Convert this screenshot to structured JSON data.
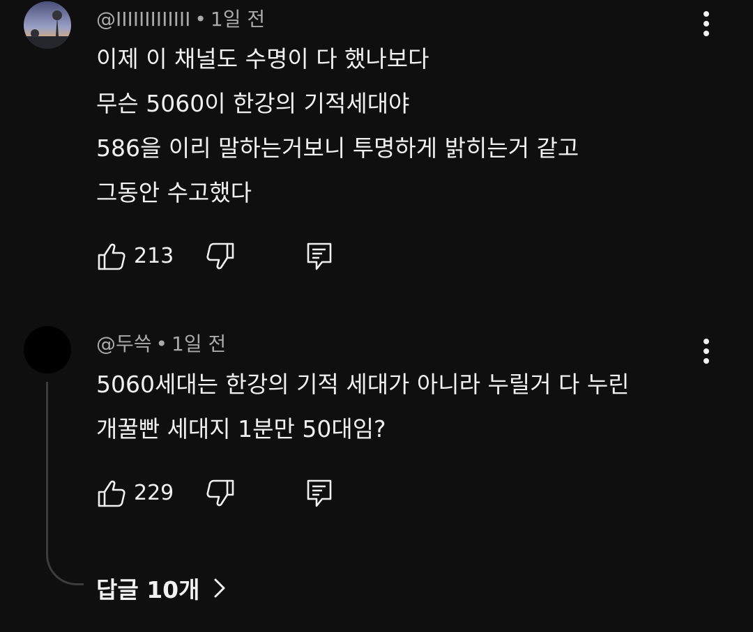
{
  "comments": [
    {
      "author": "@IIIIIIIIIIIII",
      "separator": "•",
      "time": "1일 전",
      "lines": [
        "이제 이 채널도 수명이 다 했나보다",
        "무슨 5060이 한강의 기적세대야",
        "586을 이리 말하는거보니 투명하게 밝히는거 같고",
        "그동안 수고했다"
      ],
      "likes": "213"
    },
    {
      "author": "@두쓱",
      "separator": "•",
      "time": "1일 전",
      "lines": [
        "5060세대는 한강의 기적 세대가 아니라 누릴거 다 누린",
        "개꿀빤 세대지 1분만 50대임?"
      ],
      "likes": "229"
    }
  ],
  "replies": {
    "label": "답글 10개"
  },
  "icons": {
    "like": "thumbs-up-icon",
    "dislike": "thumbs-down-icon",
    "reply": "reply-comment-icon",
    "menu": "more-vertical-icon",
    "chevron": "chevron-right-icon"
  },
  "colors": {
    "background": "#0f0f0f",
    "text": "#f1f1f1",
    "meta": "#aaaaaa"
  }
}
